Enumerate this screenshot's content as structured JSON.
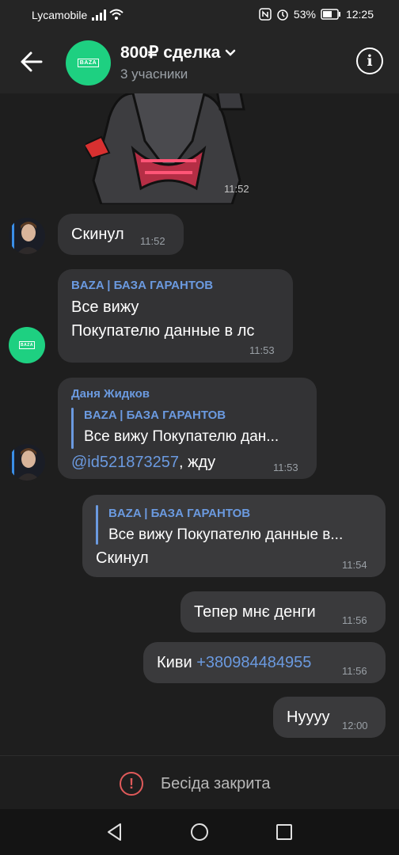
{
  "status_bar": {
    "carrier": "Lycamobile",
    "battery": "53%",
    "time": "12:25"
  },
  "header": {
    "title": "800₽ сделка",
    "subtitle": "3 учасники",
    "avatar_logo": "BAZA"
  },
  "messages": {
    "sticker_time": "11:52",
    "m1": {
      "text": "Скинул",
      "time": "11:52"
    },
    "m2": {
      "sender": "BAZA | БАЗА ГАРАНТОВ",
      "line1": "Все вижу",
      "line2": "Покупателю данные в лс",
      "time": "11:53"
    },
    "m3": {
      "sender": "Даня Жидков",
      "quote_name": "BAZA | БАЗА ГАРАНТОВ",
      "quote_text": "Все вижу Покупателю дан...",
      "mention": "@id521873257",
      "text": ",  жду",
      "time": "11:53"
    },
    "m4": {
      "quote_name": "BAZA | БАЗА ГАРАНТОВ",
      "quote_text": "Все вижу Покупателю данные в...",
      "text": "Скинул",
      "time": "11:54"
    },
    "m5": {
      "text": "Тепер мнє денги",
      "time": "11:56"
    },
    "m6": {
      "text": "Киви ",
      "phone": "+380984484955",
      "time": "11:56"
    },
    "m7": {
      "text": "Нуууу",
      "time": "12:00"
    }
  },
  "footer": {
    "closed_label": "Бесіда закрита"
  },
  "colors": {
    "accent_green": "#1ed081",
    "link_blue": "#6b9ae0",
    "alert_red": "#e05a5a"
  }
}
